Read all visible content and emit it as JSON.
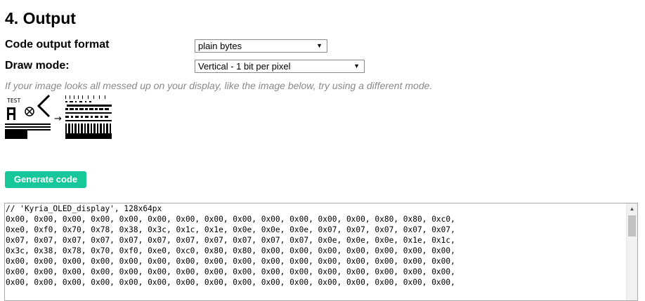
{
  "section": {
    "title": "4. Output"
  },
  "code_format": {
    "label": "Code output format",
    "selected": "plain bytes"
  },
  "draw_mode": {
    "label": "Draw mode:",
    "selected": "Vertical - 1 bit per pixel"
  },
  "hint": {
    "text": "If your image looks all messed up on your display, like the image below, try using a different mode."
  },
  "example_image": {
    "label": "TEST",
    "arrow": "→"
  },
  "generate": {
    "label": "Generate code"
  },
  "code_output": {
    "lines": [
      "// 'Kyria_OLED_display', 128x64px",
      "0x00, 0x00, 0x00, 0x00, 0x00, 0x00, 0x00, 0x00, 0x00, 0x00, 0x00, 0x00, 0x00, 0x80, 0x80, 0xc0,",
      "0xe0, 0xf0, 0x70, 0x78, 0x38, 0x3c, 0x1c, 0x1e, 0x0e, 0x0e, 0x0e, 0x07, 0x07, 0x07, 0x07, 0x07,",
      "0x07, 0x07, 0x07, 0x07, 0x07, 0x07, 0x07, 0x07, 0x07, 0x07, 0x07, 0x0e, 0x0e, 0x0e, 0x1e, 0x1c,",
      "0x3c, 0x38, 0x78, 0x70, 0xf0, 0xe0, 0xc0, 0x80, 0x80, 0x00, 0x00, 0x00, 0x00, 0x00, 0x00, 0x00,",
      "0x00, 0x00, 0x00, 0x00, 0x00, 0x00, 0x00, 0x00, 0x00, 0x00, 0x00, 0x00, 0x00, 0x00, 0x00, 0x00,",
      "0x00, 0x00, 0x00, 0x00, 0x00, 0x00, 0x00, 0x00, 0x00, 0x00, 0x00, 0x00, 0x00, 0x00, 0x00, 0x00,",
      "0x00, 0x00, 0x00, 0x00, 0x00, 0x00, 0x00, 0x00, 0x00, 0x00, 0x00, 0x00, 0x00, 0x00, 0x00, 0x00,"
    ]
  },
  "colors": {
    "button": "#16c79a",
    "hint_text": "#8a8a8a"
  }
}
